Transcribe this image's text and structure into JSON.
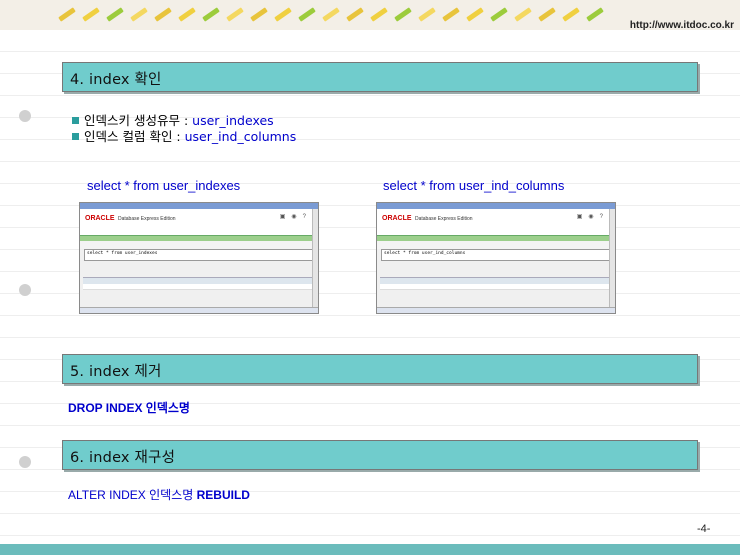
{
  "header": {
    "url": "http://www.itdoc.co.kr"
  },
  "sections": [
    {
      "title": "4. index 확인"
    },
    {
      "title": "5. index 제거"
    },
    {
      "title": "6. index 재구성"
    }
  ],
  "index_check": {
    "items": [
      {
        "label": "인덱스키 생성유무 : ",
        "value": "user_indexes"
      },
      {
        "label": "인덱스 컬럼 확인 : ",
        "value": "user_ind_columns"
      }
    ],
    "captions": [
      "select * from user_indexes",
      "select * from user_ind_columns"
    ],
    "screenshots": [
      {
        "brand": "ORACLE",
        "edition": "Database Express Edition",
        "sql": "select * from user_indexes"
      },
      {
        "brand": "ORACLE",
        "edition": "Database Express Edition",
        "sql": "select * from user_ind_columns"
      }
    ]
  },
  "drop": {
    "text": "DROP INDEX 인덱스명"
  },
  "rebuild": {
    "prefix": "ALTER INDEX  인덱스명 ",
    "keyword": "REBUILD"
  },
  "page_number": "-4-",
  "colors": {
    "section_bar": "#70cccc",
    "bottom_band": "#6bbcbc",
    "code_blue": "#0000cc"
  }
}
